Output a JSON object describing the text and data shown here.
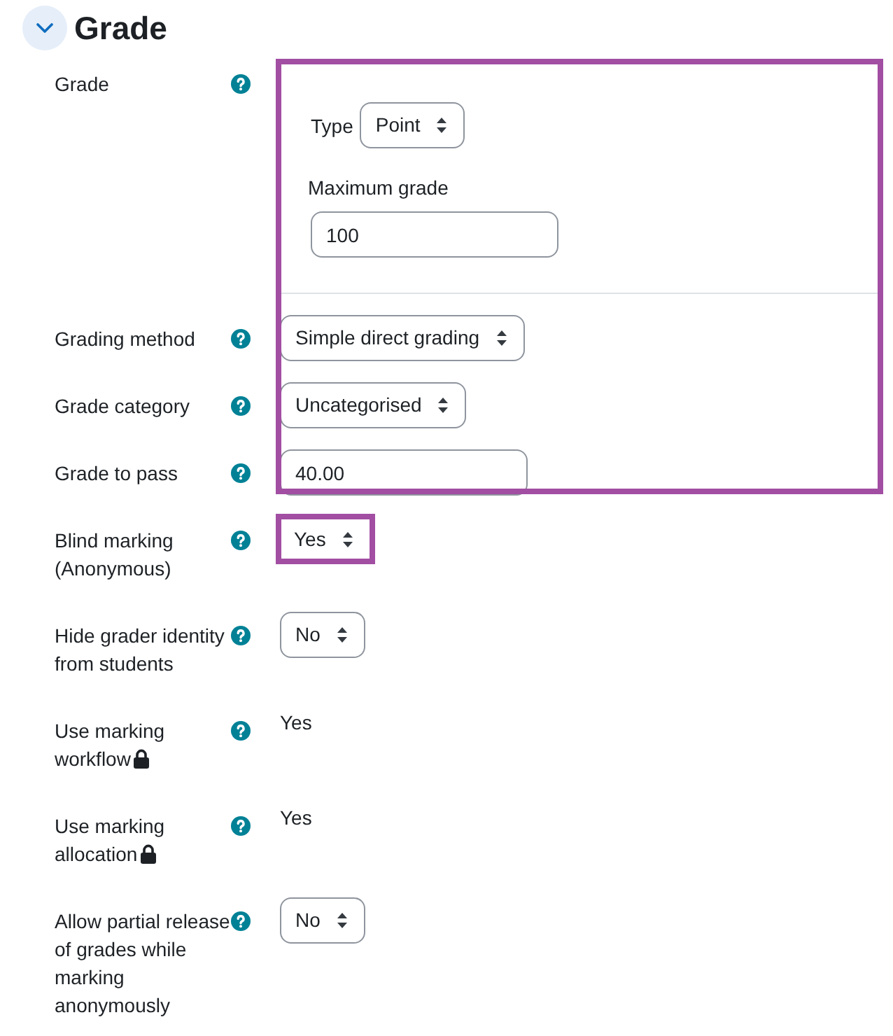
{
  "section": {
    "title": "Grade",
    "expanded": true
  },
  "groups": [
    {
      "kind": "panel",
      "fields": [
        {
          "label": "Grade",
          "locked": false,
          "kind": "compound",
          "parts": [
            {
              "kind": "select",
              "label": "Type",
              "value": "Point"
            },
            {
              "kind": "text",
              "label": "Maximum grade",
              "value": "100"
            }
          ]
        },
        {
          "label": "Grading method",
          "locked": false,
          "kind": "select",
          "value": "Simple direct grading"
        },
        {
          "label": "Grade category",
          "locked": false,
          "kind": "select",
          "value": "Uncategorised"
        },
        {
          "label": "Grade to pass",
          "locked": false,
          "kind": "text",
          "value": "40.00"
        }
      ]
    },
    {
      "kind": "control",
      "fields": [
        {
          "label": "Blind marking (Anonymous)",
          "locked": false,
          "kind": "select",
          "value": "Yes"
        }
      ]
    },
    {
      "kind": "plain",
      "fields": [
        {
          "label": "Hide grader identity from students",
          "locked": false,
          "kind": "select",
          "value": "No"
        },
        {
          "label": "Use marking workflow",
          "locked": true,
          "kind": "static",
          "value": "Yes"
        },
        {
          "label": "Use marking allocation",
          "locked": true,
          "kind": "static",
          "value": "Yes"
        },
        {
          "label": "Allow partial release of grades while marking anonymously",
          "locked": false,
          "kind": "select",
          "value": "No"
        }
      ]
    }
  ]
}
